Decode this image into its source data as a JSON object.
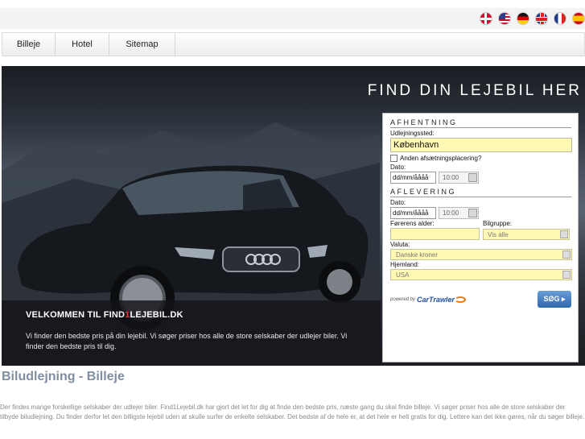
{
  "languages": [
    {
      "icon": "flag-denmark-icon",
      "cls": "flag-dk"
    },
    {
      "icon": "flag-usa-icon",
      "cls": "flag-us"
    },
    {
      "icon": "flag-germany-icon",
      "cls": "flag-de"
    },
    {
      "icon": "flag-uk-icon",
      "cls": "flag-gb"
    },
    {
      "icon": "flag-france-icon",
      "cls": "flag-fr"
    },
    {
      "icon": "flag-spain-icon",
      "cls": "flag-es"
    }
  ],
  "nav": {
    "items": [
      "Billeje",
      "Hotel",
      "Sitemap"
    ]
  },
  "hero": {
    "title": "FIND DIN LEJEBIL HER",
    "welcome_title_pre": "VELKOMMEN TIL FIND",
    "welcome_title_accent": "1",
    "welcome_title_post": "LEJEBIL.DK",
    "welcome_text": "Vi finder den bedste pris på din lejebil. Vi søger priser hos alle de store selskaber der udlejer biler. Vi finder den bedste pris til dig.",
    "accent_color": "#e33030"
  },
  "form": {
    "pickup_heading": "AFHENTNING",
    "location_label": "Udlejningssted:",
    "location_value": "København",
    "other_return_label": "Anden afsætningsplacering?",
    "pickup_date_label": "Dato:",
    "pickup_date_value": "dd/mm/åååå",
    "pickup_time_value": "10:00",
    "return_heading": "AFLEVERING",
    "return_date_label": "Dato:",
    "return_date_value": "dd/mm/åååå",
    "return_time_value": "10:00",
    "driver_age_label": "Førerens alder:",
    "car_group_label": "Bilgruppe:",
    "car_group_value": "Vis alle",
    "currency_label": "Valuta:",
    "currency_value": "Danske kroner",
    "country_label": "Hjemland:",
    "country_value": "USA",
    "powered_by": "powered by",
    "partner": "CarTrawler",
    "search_label": "SØG ▸",
    "field_color": "#fff9b4",
    "button_color": "#2f67ad"
  },
  "content": {
    "title": "Biludlejning - Billeje",
    "text": "Der findes mange forskellige selskaber der udlejer biler. Find1Lejebil.dk har gjort det let for dig at finde den bedste pris, næste gang du skal finde billeje. Vi søger priser hos alle de store selskaber der tilbyde biludlejning. Du finder derfor let den billigste lejebil uden at skulle surfer de enkelte selskaber. Det bedste af de hele er, at det hele er helt gratis for dig. Lettere kan det ikke gøres, når du søger billeje."
  }
}
